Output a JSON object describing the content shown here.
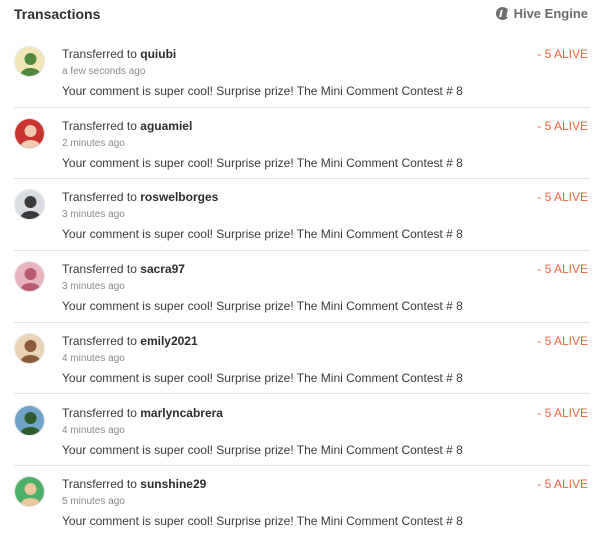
{
  "header": {
    "title": "Transactions",
    "engine_link": "Hive Engine"
  },
  "transactions": [
    {
      "prefix": "Transferred to",
      "user": "quiubi",
      "time": "a few seconds ago",
      "memo": "Your comment is super cool! Surprise prize! The Mini Comment Contest # 8",
      "amount": "- 5 ALIVE",
      "avatar_bg": "#f2e6b8",
      "avatar_fg": "#4f8a3c"
    },
    {
      "prefix": "Transferred to",
      "user": "aguamiel",
      "time": "2 minutes ago",
      "memo": "Your comment is super cool! Surprise prize! The Mini Comment Contest # 8",
      "amount": "- 5 ALIVE",
      "avatar_bg": "#c8342f",
      "avatar_fg": "#f1c9b0"
    },
    {
      "prefix": "Transferred to",
      "user": "roswelborges",
      "time": "3 minutes ago",
      "memo": "Your comment is super cool! Surprise prize! The Mini Comment Contest # 8",
      "amount": "- 5 ALIVE",
      "avatar_bg": "#d9dde2",
      "avatar_fg": "#3b3a3a"
    },
    {
      "prefix": "Transferred to",
      "user": "sacra97",
      "time": "3 minutes ago",
      "memo": "Your comment is super cool! Surprise prize! The Mini Comment Contest # 8",
      "amount": "- 5 ALIVE",
      "avatar_bg": "#e8b4c0",
      "avatar_fg": "#b85b6f"
    },
    {
      "prefix": "Transferred to",
      "user": "emily2021",
      "time": "4 minutes ago",
      "memo": "Your comment is super cool! Surprise prize! The Mini Comment Contest # 8",
      "amount": "- 5 ALIVE",
      "avatar_bg": "#e9d4b8",
      "avatar_fg": "#8a5a3a"
    },
    {
      "prefix": "Transferred to",
      "user": "marlyncabrera",
      "time": "4 minutes ago",
      "memo": "Your comment is super cool! Surprise prize! The Mini Comment Contest # 8",
      "amount": "- 5 ALIVE",
      "avatar_bg": "#6fa3c8",
      "avatar_fg": "#2e5a2c"
    },
    {
      "prefix": "Transferred to",
      "user": "sunshine29",
      "time": "5 minutes ago",
      "memo": "Your comment is super cool! Surprise prize! The Mini Comment Contest # 8",
      "amount": "- 5 ALIVE",
      "avatar_bg": "#4caf6a",
      "avatar_fg": "#e9c79a"
    }
  ]
}
